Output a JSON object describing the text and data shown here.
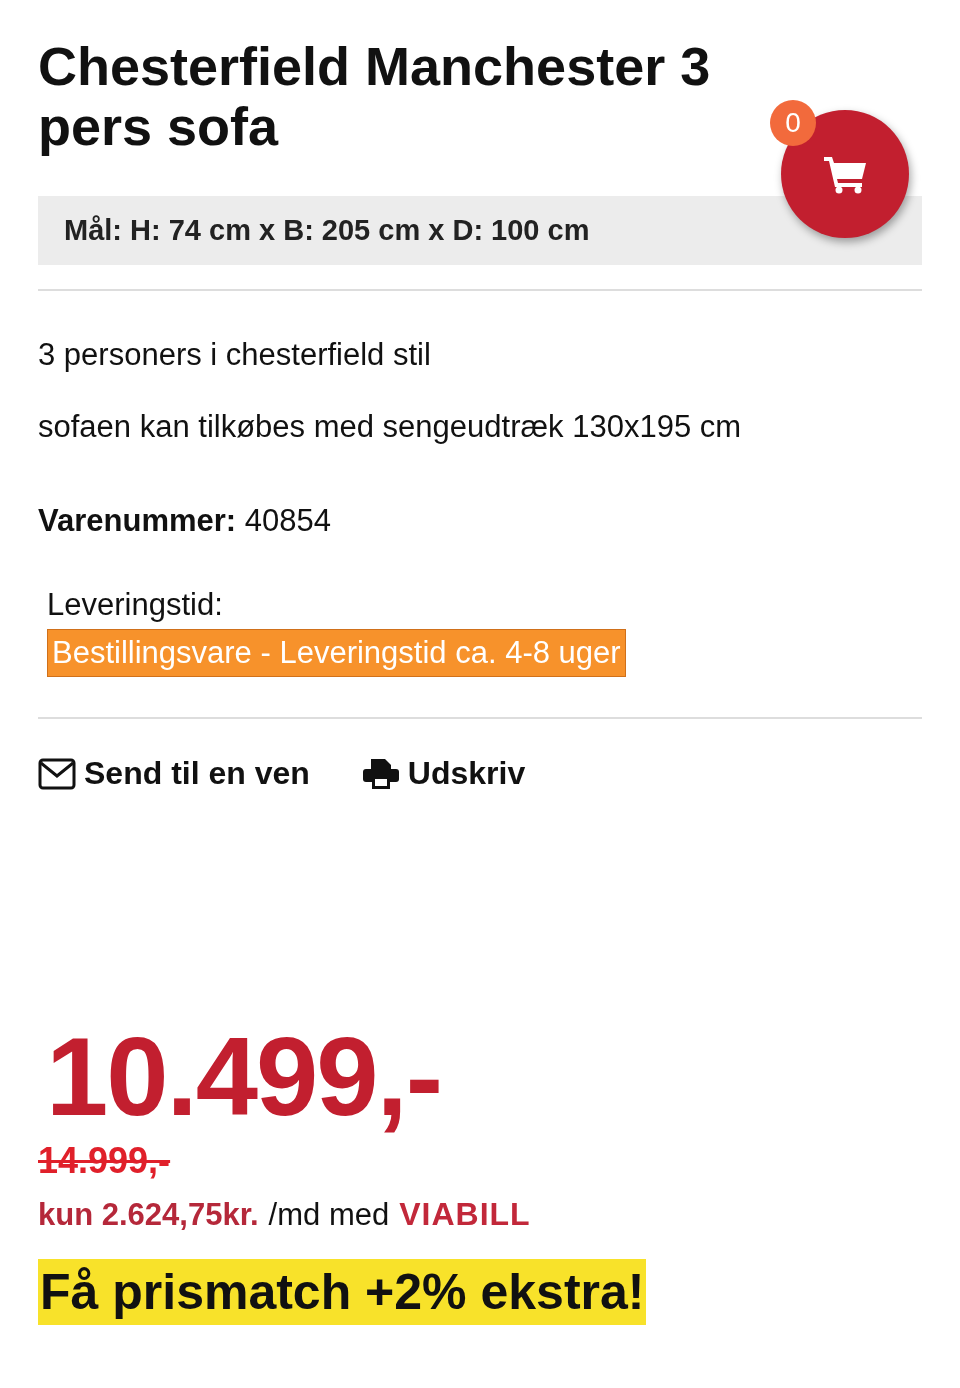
{
  "title": "Chesterfield Manchester 3 pers sofa",
  "cart": {
    "count": "0"
  },
  "dimensions": "Mål: H: 74 cm x B: 205 cm x D: 100 cm",
  "description": [
    "3 personers i chesterfield stil",
    "sofaen kan tilkøbes med sengeudtræk 130x195 cm"
  ],
  "item_number": {
    "label": "Varenummer:",
    "value": "40854"
  },
  "delivery": {
    "label": "Leveringstid:",
    "status": "Bestillingsvare - Leveringstid ca. 4-8 uger"
  },
  "actions": [
    {
      "kind": "mail",
      "label": "Send til en ven"
    },
    {
      "kind": "print",
      "label": "Udskriv"
    }
  ],
  "price": {
    "current": "10.499,-",
    "old": "14.999,-",
    "installment": "kun 2.624,75kr.",
    "per": "/md med",
    "provider": "VIABILL"
  },
  "promo": "Få prismatch +2% ekstra!"
}
